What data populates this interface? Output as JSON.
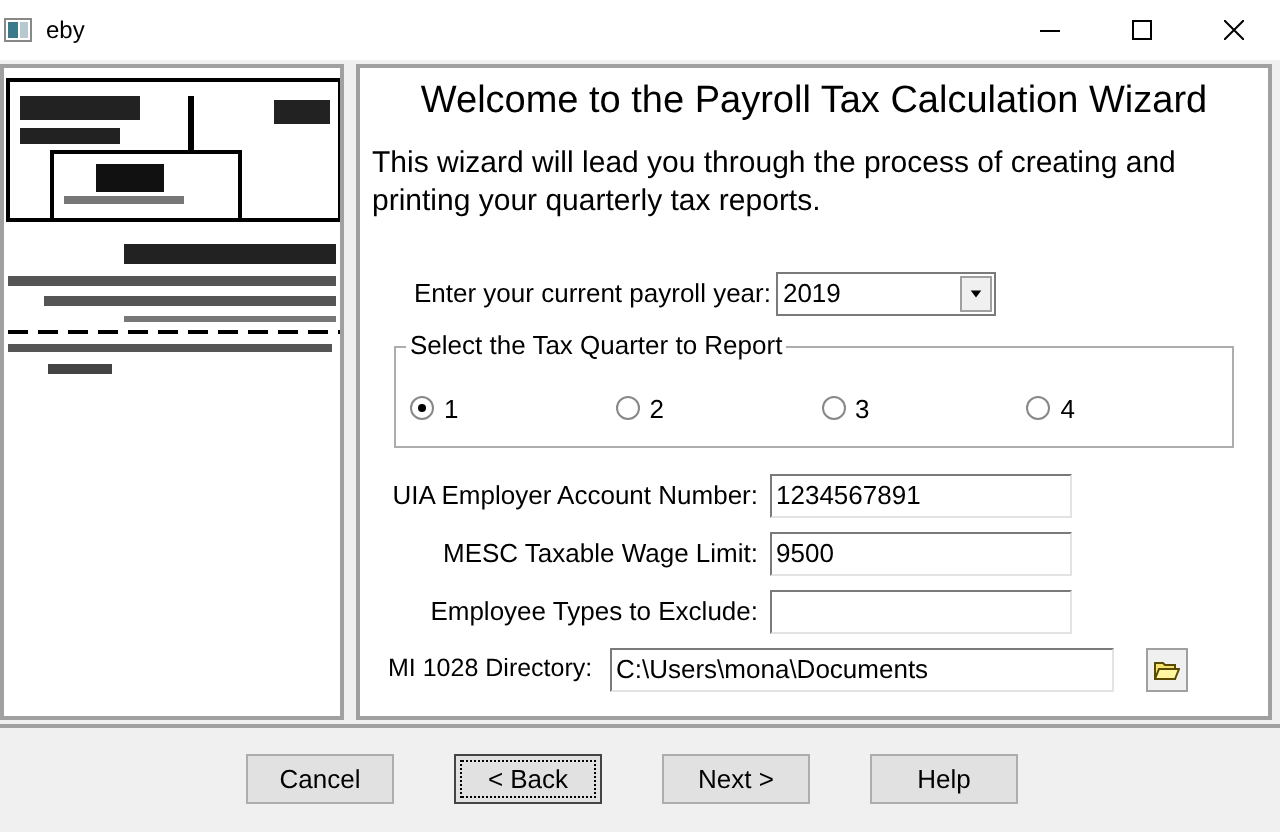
{
  "window": {
    "title": "eby"
  },
  "heading": "Welcome to the Payroll Tax Calculation Wizard",
  "intro": "This wizard will  lead you through the process of creating  and printing your quarterly tax reports.",
  "year": {
    "label": "Enter your current payroll year:",
    "value": "2019"
  },
  "quarter_group": {
    "title": "Select the Tax Quarter to Report",
    "options": [
      {
        "label": "1",
        "selected": true
      },
      {
        "label": "2",
        "selected": false
      },
      {
        "label": "3",
        "selected": false
      },
      {
        "label": "4",
        "selected": false
      }
    ]
  },
  "fields": [
    {
      "label": "UIA Employer Account Number:",
      "value": "1234567891"
    },
    {
      "label": "MESC Taxable Wage Limit:",
      "value": "9500"
    },
    {
      "label": "Employee Types to Exclude:"
    }
  ],
  "directory": {
    "label": "MI 1028 Directory:",
    "value": "C:\\Users\\mona\\Documents"
  },
  "buttons": [
    {
      "label": "Cancel",
      "focused": false
    },
    {
      "label": "< Back",
      "focused": true
    },
    {
      "label": "Next >",
      "focused": false
    },
    {
      "label": "Help",
      "focused": false
    }
  ]
}
